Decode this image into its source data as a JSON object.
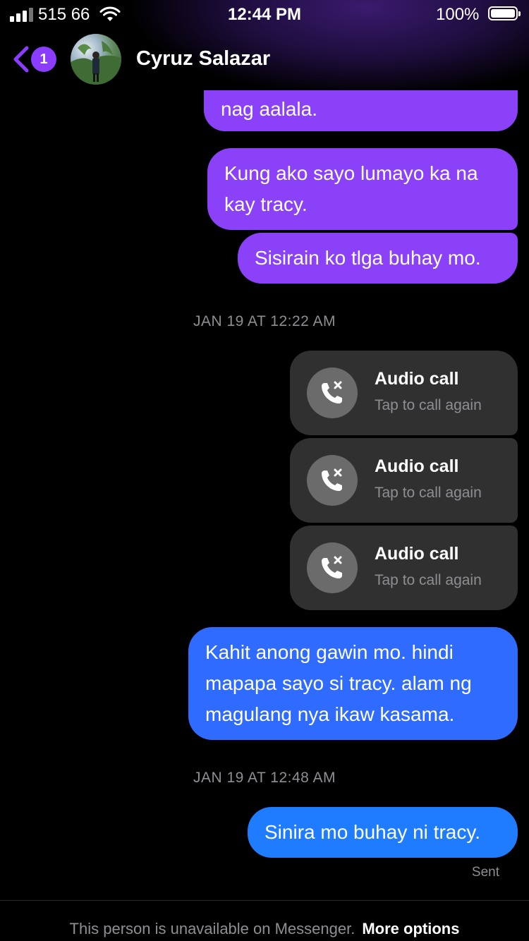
{
  "status_bar": {
    "carrier": "515 66",
    "time": "12:44 PM",
    "battery_percent": "100%"
  },
  "header": {
    "back_badge_count": "1",
    "contact_name": "Cyruz Salazar"
  },
  "messages": [
    {
      "text": "nag aalala."
    },
    {
      "text": "Kung ako sayo lumayo ka na kay tracy."
    },
    {
      "text": "Sisirain ko tlga buhay mo."
    },
    {
      "timestamp": "JAN 19 AT 12:22 AM"
    },
    {
      "call_title": "Audio call",
      "call_subtitle": "Tap to call again"
    },
    {
      "call_title": "Audio call",
      "call_subtitle": "Tap to call again"
    },
    {
      "call_title": "Audio call",
      "call_subtitle": "Tap to call again"
    },
    {
      "text": "Kahit anong gawin mo. hindi mapapa sayo si tracy. alam ng magulang nya ikaw kasama."
    },
    {
      "timestamp": "JAN 19 AT 12:48 AM"
    },
    {
      "text": "Sinira mo buhay ni tracy."
    }
  ],
  "delivery_status": "Sent",
  "footer": {
    "notice": "This person is unavailable on Messenger.",
    "more_options": "More options"
  },
  "colors": {
    "accent_purple": "#8a41f7",
    "bubble_blue": "#2f6bff",
    "call_card": "#303030",
    "muted_text": "#8e8e93"
  }
}
